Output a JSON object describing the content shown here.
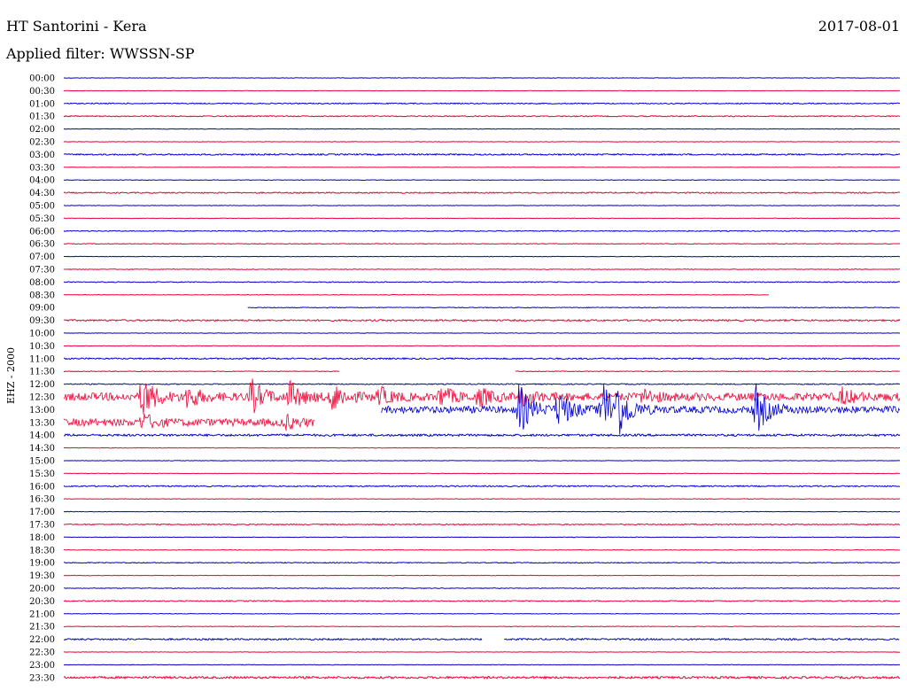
{
  "header": {
    "station": "HT Santorini - Kera",
    "date": "2017-08-01",
    "filter_label": "Applied filter: WWSSN-SP"
  },
  "chart_data": {
    "type": "line",
    "ylabel": "EHZ - 2000",
    "tick_labels": [
      "00:00",
      "00:30",
      "01:00",
      "01:30",
      "02:00",
      "02:30",
      "03:00",
      "03:30",
      "04:00",
      "04:30",
      "05:00",
      "05:30",
      "06:00",
      "06:30",
      "07:00",
      "07:30",
      "08:00",
      "08:30",
      "09:00",
      "09:30",
      "10:00",
      "10:30",
      "11:00",
      "11:30",
      "12:00",
      "12:30",
      "13:00",
      "13:30",
      "14:00",
      "14:30",
      "15:00",
      "15:30",
      "16:00",
      "16:30",
      "17:00",
      "17:30",
      "18:00",
      "18:30",
      "19:00",
      "19:30",
      "20:00",
      "20:30",
      "21:00",
      "21:30",
      "22:00",
      "22:30",
      "23:00",
      "23:30"
    ],
    "trace_colors": [
      "#0000cc",
      "#ee0033"
    ],
    "x_range_minutes": [
      0,
      30
    ],
    "noise_level": [
      0.3,
      0.2,
      0.6,
      0.6,
      0.3,
      0.3,
      0.8,
      0.2,
      0.3,
      0.7,
      0.3,
      0.3,
      0.5,
      0.4,
      0.3,
      0.4,
      0.5,
      0.3,
      0.4,
      0.9,
      0.3,
      0.3,
      0.8,
      0.4,
      0.6,
      4.5,
      4.0,
      4.2,
      1.2,
      0.3,
      0.3,
      0.3,
      0.7,
      0.3,
      0.3,
      0.6,
      0.3,
      0.3,
      0.5,
      0.3,
      0.4,
      0.6,
      0.3,
      0.3,
      0.9,
      0.3,
      0.3,
      1.2
    ],
    "trace_coverage": [
      [
        [
          0,
          30
        ]
      ],
      [
        [
          0,
          30
        ]
      ],
      [
        [
          0,
          30
        ]
      ],
      [
        [
          0,
          30
        ]
      ],
      [
        [
          0,
          30
        ]
      ],
      [
        [
          0,
          30
        ]
      ],
      [
        [
          0,
          30
        ]
      ],
      [
        [
          0,
          30
        ]
      ],
      [
        [
          0,
          30
        ]
      ],
      [
        [
          0,
          30
        ]
      ],
      [
        [
          0,
          30
        ]
      ],
      [
        [
          0,
          30
        ]
      ],
      [
        [
          0,
          30
        ]
      ],
      [
        [
          0,
          30
        ]
      ],
      [
        [
          0,
          30
        ]
      ],
      [
        [
          0,
          30
        ]
      ],
      [
        [
          0,
          30
        ]
      ],
      [
        [
          0,
          25.3
        ]
      ],
      [
        [
          6.6,
          30
        ]
      ],
      [
        [
          0,
          30
        ]
      ],
      [
        [
          0,
          30
        ]
      ],
      [
        [
          0,
          30
        ]
      ],
      [
        [
          0,
          30
        ]
      ],
      [
        [
          0,
          9.9
        ],
        [
          16.2,
          30
        ]
      ],
      [
        [
          0,
          30
        ]
      ],
      [
        [
          0,
          30
        ]
      ],
      [
        [
          11.4,
          30
        ]
      ],
      [
        [
          0,
          9
        ]
      ],
      [
        [
          0,
          30
        ]
      ],
      [
        [
          0,
          30
        ]
      ],
      [
        [
          0,
          30
        ]
      ],
      [
        [
          0,
          30
        ]
      ],
      [
        [
          0,
          30
        ]
      ],
      [
        [
          0,
          30
        ]
      ],
      [
        [
          0,
          30
        ]
      ],
      [
        [
          0,
          30
        ]
      ],
      [
        [
          0,
          30
        ]
      ],
      [
        [
          0,
          30
        ]
      ],
      [
        [
          0,
          30
        ]
      ],
      [
        [
          0,
          30
        ]
      ],
      [
        [
          0,
          30
        ]
      ],
      [
        [
          0,
          30
        ]
      ],
      [
        [
          0,
          30
        ]
      ],
      [
        [
          0,
          30
        ]
      ],
      [
        [
          0,
          15
        ],
        [
          15.8,
          30
        ]
      ],
      [
        [
          0,
          30
        ]
      ],
      [
        [
          0,
          30
        ]
      ],
      [
        [
          0,
          30
        ]
      ]
    ],
    "events": [
      {
        "row": 25,
        "minute": 2.8,
        "amplitude": 26
      },
      {
        "row": 25,
        "minute": 4.4,
        "amplitude": 14
      },
      {
        "row": 25,
        "minute": 6.7,
        "amplitude": 20
      },
      {
        "row": 25,
        "minute": 8.1,
        "amplitude": 16
      },
      {
        "row": 25,
        "minute": 9.6,
        "amplitude": 18
      },
      {
        "row": 25,
        "minute": 11.3,
        "amplitude": 10
      },
      {
        "row": 25,
        "minute": 13.5,
        "amplitude": 12
      },
      {
        "row": 25,
        "minute": 14.9,
        "amplitude": 10
      },
      {
        "row": 25,
        "minute": 16.4,
        "amplitude": 10
      },
      {
        "row": 25,
        "minute": 20.8,
        "amplitude": 8
      },
      {
        "row": 25,
        "minute": 27.9,
        "amplitude": 9
      },
      {
        "row": 26,
        "minute": 16.3,
        "amplitude": 30
      },
      {
        "row": 26,
        "minute": 17.7,
        "amplitude": 26
      },
      {
        "row": 26,
        "minute": 19.3,
        "amplitude": 38
      },
      {
        "row": 26,
        "minute": 19.8,
        "amplitude": 30
      },
      {
        "row": 26,
        "minute": 24.8,
        "amplitude": 30
      },
      {
        "row": 27,
        "minute": 2.8,
        "amplitude": 10
      },
      {
        "row": 27,
        "minute": 7.9,
        "amplitude": 8
      }
    ]
  }
}
